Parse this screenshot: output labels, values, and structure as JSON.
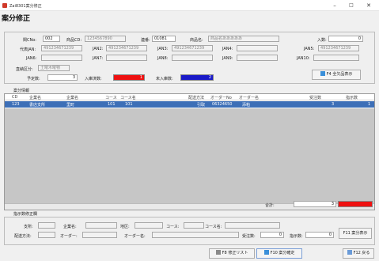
{
  "window": {
    "title": "Zai8301案分修正",
    "minimize": "–",
    "maximize": "□",
    "close": "✕"
  },
  "page": {
    "heading": "案分修正"
  },
  "form": {
    "kanno_label": "閑CNo:",
    "kanno_value": "002",
    "shohin_cd_label": "商品CD:",
    "shohin_cd_value": "1234567890",
    "densho_label": "連番:",
    "densho_value": "01081",
    "shohin_mei_label": "商品名:",
    "shohin_mei_value": "商品名あああああ",
    "irisu_label": "入数:",
    "irisu_value": "0",
    "daihyo_jan_label": "代表JAN:",
    "daihyo_jan_value": "491234671239",
    "jan2_label": "JAN2:",
    "jan2_value": "491234671239",
    "jan3_label": "JAN3:",
    "jan3_value": "491234671239",
    "jan4_label": "JAN4:",
    "jan4_value": "",
    "jan5_label": "JAN5:",
    "jan5_value": "491234671239",
    "jan6_label": "JAN6:",
    "jan6_value": "",
    "jan7_label": "JAN7:",
    "jan7_value": "",
    "jan8_label": "JAN8:",
    "jan8_value": "",
    "jan9_label": "JAN9:",
    "jan9_value": "",
    "jan10_label": "JAN10:",
    "jan10_value": "",
    "shohin_kubun_label": "直納区分:",
    "shohin_kubun_value": "土曜木曜物",
    "yotei_label": "予定数:",
    "yotei_value": "3",
    "nyuka_zumi_label": "入庫済数:",
    "nyuka_zumi_value": "1",
    "minyuka_label": "未入庫数:",
    "minyuka_value": "2",
    "zen_button": "F4 全欠品表示"
  },
  "colors": {
    "nyuka_zumi": "#ee1111",
    "minyuka": "#1a1ac8",
    "row_selected": "#3d6fb7"
  },
  "grid": {
    "section_label": "案分情報",
    "headers": [
      "CD",
      "企業名",
      "企業名",
      "コース",
      "コース名",
      "配送方法",
      "オーダーNo",
      "オーダー名",
      "受注数",
      "指示数"
    ],
    "rows": [
      [
        "123",
        "書店支所",
        "里町",
        "101",
        "101",
        "引取",
        "06324650",
        "添粕",
        "3",
        "1"
      ]
    ],
    "total_label": "合計:",
    "total_value": "3",
    "total_color": "#ee1111"
  },
  "edit": {
    "section_label": "指示数修正欄",
    "shiten_label": "支所:",
    "shiten_value": "",
    "kigyo_label": "企業名:",
    "kigyo_value": "",
    "chiku_label": "地区:",
    "chiku_value": "",
    "course_label": "コース:",
    "course_value": "",
    "course_mei_label": "コース名:",
    "course_mei_value": "",
    "haiso_label": "配送方法:",
    "haiso_value": "",
    "order_label": "オーダー:",
    "order_value": "",
    "order_mei_label": "オーダー名:",
    "order_mei_value": "",
    "juchu_label": "受注数:",
    "juchu_value": "0",
    "shiji_label": "指示数:",
    "shiji_value": "0",
    "f11_button": "F11 案分表示"
  },
  "footer": {
    "f8_button": "F8 修正リスト",
    "f10_button": "F10 案分確定",
    "f12_button": "F12 戻る"
  }
}
